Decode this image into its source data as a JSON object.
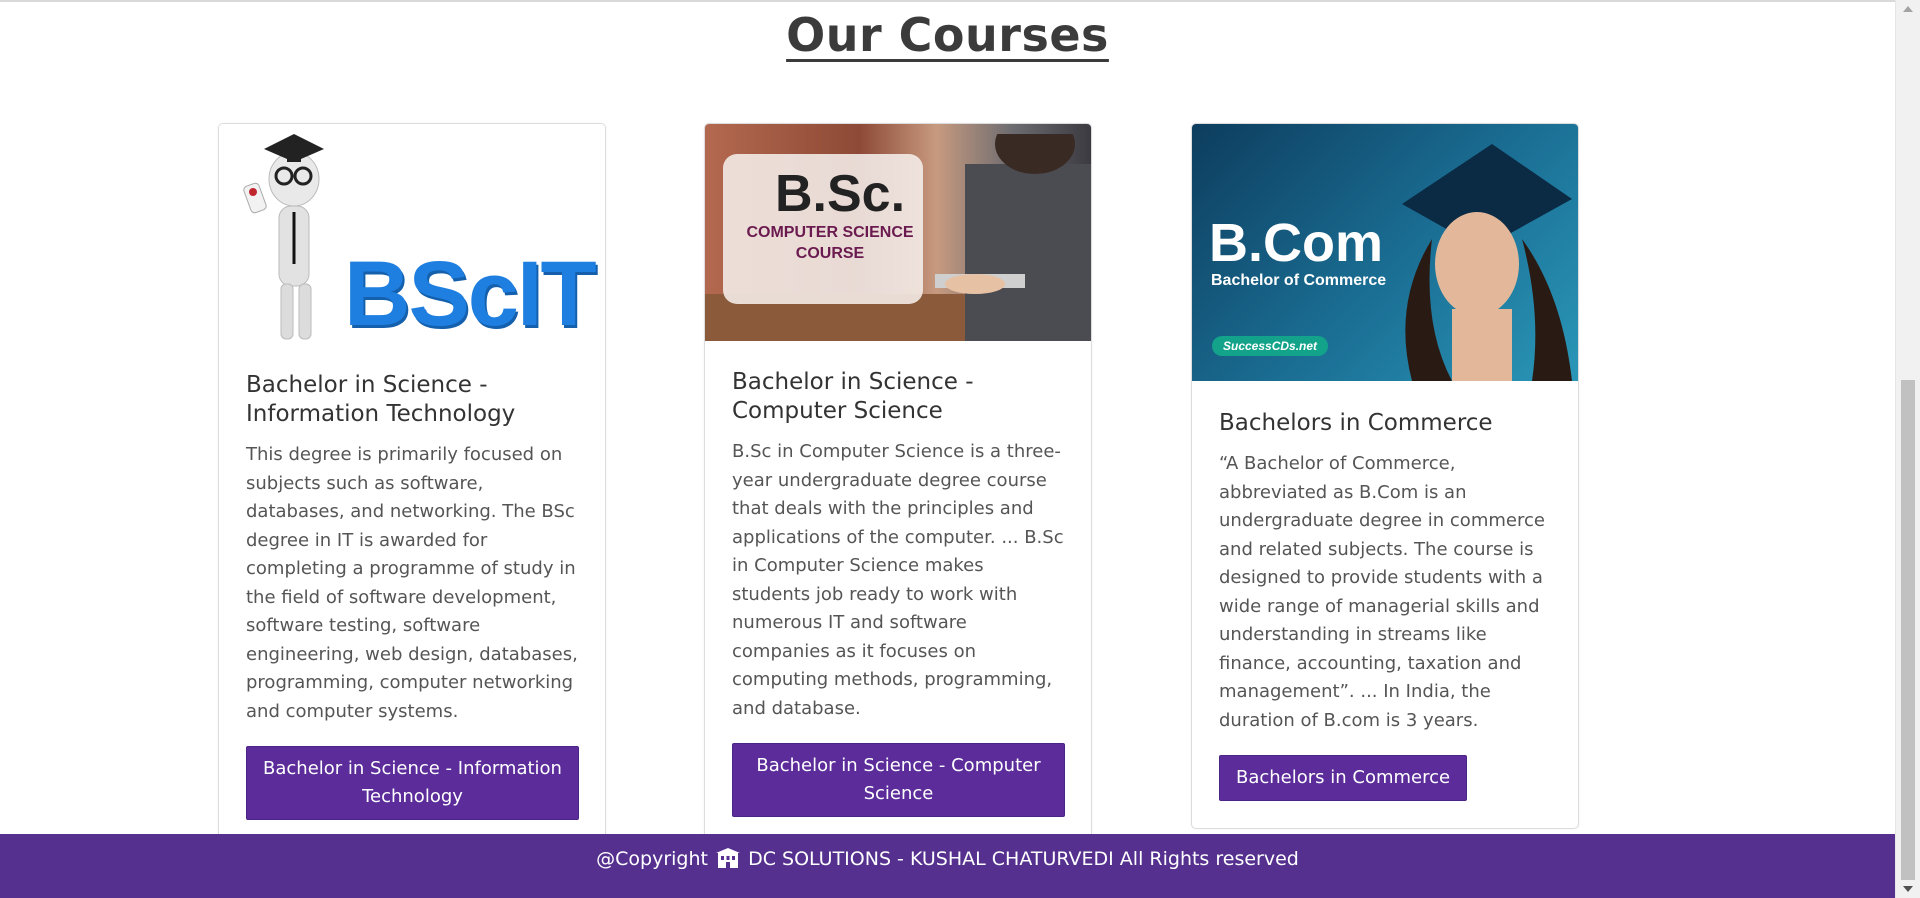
{
  "page": {
    "title": "Our Courses"
  },
  "courses": [
    {
      "image_text": "BScIT",
      "title": "Bachelor in Science - Information Technology",
      "description": "This degree is primarily focused on subjects such as software, databases, and networking. The BSc degree in IT is awarded for completing a programme of study in the field of software development, software testing, software engineering, web design, databases, programming, computer networking and computer systems.",
      "button_label": "Bachelor in Science - Information Technology"
    },
    {
      "image_text": "B.Sc.",
      "image_subtext_1": "COMPUTER SCIENCE",
      "image_subtext_2": "COURSE",
      "title": "Bachelor in Science - Computer Science",
      "description": "B.Sc in Computer Science is a three-year undergraduate degree course that deals with the principles and applications of the computer. ... B.Sc in Computer Science makes students job ready to work with numerous IT and software companies as it focuses on computing methods, programming, and database.",
      "button_label": "Bachelor in Science - Computer Science"
    },
    {
      "image_text": "B.Com",
      "image_subtext": "Bachelor of Commerce",
      "image_tag": "SuccessCDs.net",
      "title": "Bachelors in Commerce",
      "description": "“A Bachelor of Commerce, abbreviated as B.Com is an undergraduate degree in commerce and related subjects. The course is designed to provide students with a wide range of managerial skills and understanding in streams like finance, accounting, taxation and management”. ... In India, the duration of B.com is 3 years.",
      "button_label": "Bachelors in Commerce"
    }
  ],
  "footer": {
    "prefix": "@Copyright",
    "icon": "building-icon",
    "text": "DC SOLUTIONS - KUSHAL CHATURVEDI All Rights reserved"
  },
  "colors": {
    "accent": "#5b2c9a",
    "footer_bg": "#55308f"
  }
}
